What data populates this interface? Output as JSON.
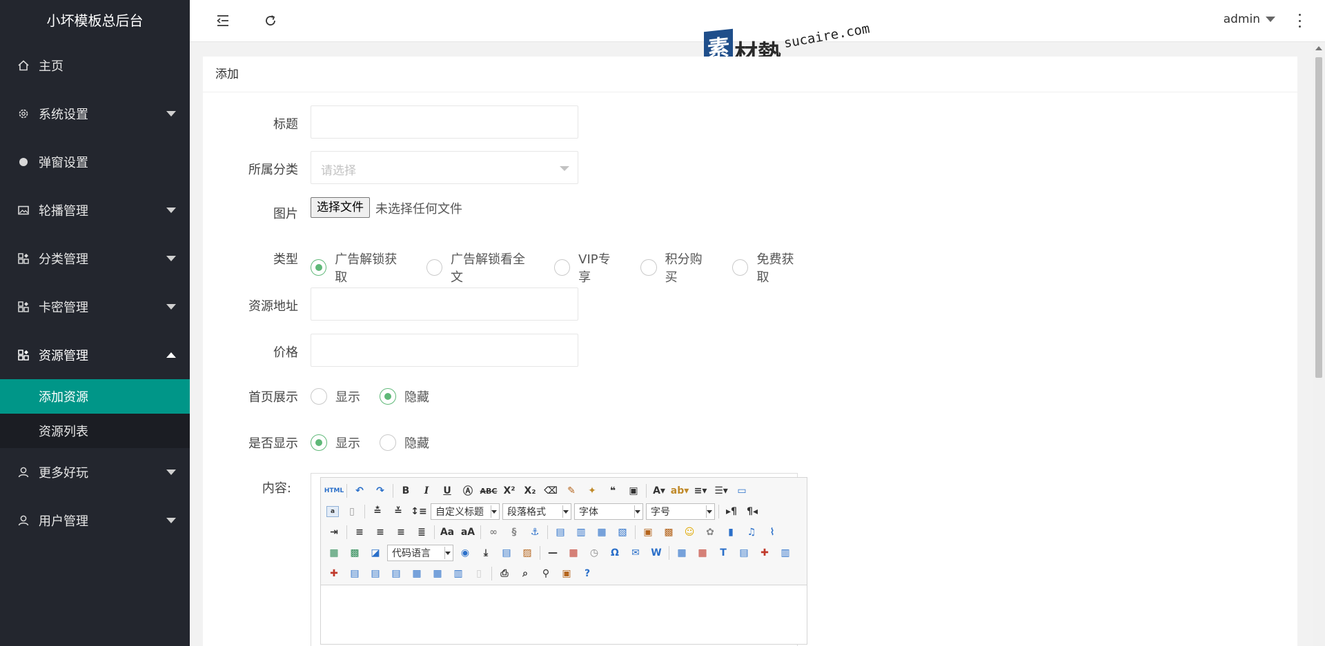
{
  "app_title": "小坏模板总后台",
  "sidebar": {
    "items": [
      {
        "label": "主页",
        "icon": "home-icon",
        "expandable": false
      },
      {
        "label": "系统设置",
        "icon": "gear-icon",
        "expandable": true
      },
      {
        "label": "弹窗设置",
        "icon": "dot-icon",
        "expandable": false
      },
      {
        "label": "轮播管理",
        "icon": "image-icon",
        "expandable": true
      },
      {
        "label": "分类管理",
        "icon": "apps-icon",
        "expandable": true
      },
      {
        "label": "卡密管理",
        "icon": "apps-icon",
        "expandable": true
      },
      {
        "label": "资源管理",
        "icon": "apps-icon",
        "expandable": true,
        "expanded": true
      },
      {
        "label": "更多好玩",
        "icon": "user-icon",
        "expandable": true
      },
      {
        "label": "用户管理",
        "icon": "user-icon",
        "expandable": true
      }
    ],
    "subitems": [
      {
        "label": "添加资源",
        "selected": true
      },
      {
        "label": "资源列表",
        "selected": false
      }
    ]
  },
  "header": {
    "user": "admin",
    "icons": [
      "menu-fold-icon",
      "refresh-icon",
      "more-vertical-icon"
    ]
  },
  "watermark": {
    "box": "素",
    "cn": "材熱",
    "en": "sucaire.com"
  },
  "card": {
    "title": "添加"
  },
  "form": {
    "title_label": "标题",
    "category_label": "所属分类",
    "category_placeholder": "请选择",
    "image_label": "图片",
    "file_button": "选择文件",
    "file_status": "未选择任何文件",
    "type_label": "类型",
    "type_options": [
      {
        "label": "广告解锁获取",
        "checked": true
      },
      {
        "label": "广告解锁看全文",
        "checked": false
      },
      {
        "label": "VIP专享",
        "checked": false
      },
      {
        "label": "积分购买",
        "checked": false
      },
      {
        "label": "免费获取",
        "checked": false
      }
    ],
    "resource_url_label": "资源地址",
    "price_label": "价格",
    "homepage_label": "首页展示",
    "homepage_options": [
      {
        "label": "显示",
        "checked": false
      },
      {
        "label": "隐藏",
        "checked": true
      }
    ],
    "visible_label": "是否显示",
    "visible_options": [
      {
        "label": "显示",
        "checked": true
      },
      {
        "label": "隐藏",
        "checked": false
      }
    ],
    "content_label": "内容:"
  },
  "editor": {
    "html_label": "HTML",
    "selects": {
      "heading": "自定义标题",
      "paragraph": "段落格式",
      "font_family": "字体",
      "font_size": "字号",
      "code_lang": "代码语言"
    }
  },
  "colors": {
    "sidebar_bg": "#23262e",
    "active_green": "#009688",
    "radio_green": "#5fb878"
  }
}
